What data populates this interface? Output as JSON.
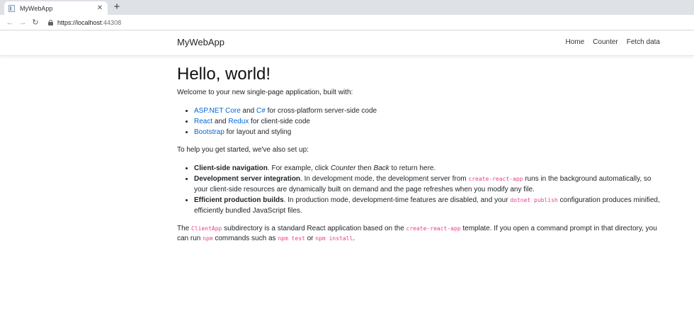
{
  "browser": {
    "tab_title": "MyWebApp",
    "tab_close": "✕",
    "new_tab": "+",
    "url_host": "https://localhost",
    "url_port": ":44308"
  },
  "navbar": {
    "brand": "MyWebApp",
    "links": [
      "Home",
      "Counter",
      "Fetch data"
    ]
  },
  "content": {
    "heading": "Hello, world!",
    "intro": "Welcome to your new single-page application, built with:",
    "built_with": {
      "item1": {
        "link1": "ASP.NET Core",
        "and": " and ",
        "link2": "C#",
        "rest": " for cross-platform server-side code"
      },
      "item2": {
        "link1": "React",
        "and": " and ",
        "link2": "Redux",
        "rest": " for client-side code"
      },
      "item3": {
        "link1": "Bootstrap",
        "rest": " for layout and styling"
      }
    },
    "setup_intro": "To help you get started, we've also set up:",
    "setup": {
      "item1": {
        "bold": "Client-side navigation",
        "t1": ". For example, click ",
        "em1": "Counter",
        "t2": " then ",
        "em2": "Back",
        "t3": " to return here."
      },
      "item2": {
        "bold": "Development server integration",
        "t1": ". In development mode, the development server from ",
        "code1": "create-react-app",
        "t2": " runs in the background automatically, so your client-side resources are dynamically built on demand and the page refreshes when you modify any file."
      },
      "item3": {
        "bold": "Efficient production builds",
        "t1": ". In production mode, development-time features are disabled, and your ",
        "code1": "dotnet publish",
        "t2": " configuration produces minified, efficiently bundled JavaScript files."
      }
    },
    "footer": {
      "t1": "The ",
      "code1": "ClientApp",
      "t2": " subdirectory is a standard React application based on the ",
      "code2": "create-react-app",
      "t3": " template. If you open a command prompt in that directory, you can run ",
      "code3": "npm",
      "t4": " commands such as ",
      "code4": "npm test",
      "t5": " or ",
      "code5": "npm install",
      "t6": "."
    }
  }
}
